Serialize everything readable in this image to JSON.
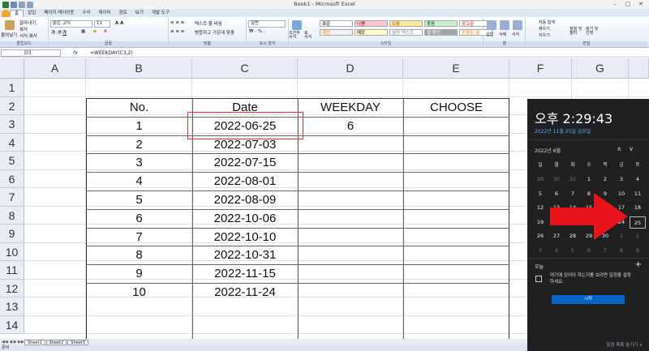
{
  "window": {
    "title": "Book1 - Microsoft Excel",
    "minimize": "–",
    "restore": "□",
    "close": "✕"
  },
  "ribbon_tabs": [
    "홈",
    "삽입",
    "페이지 레이아웃",
    "수식",
    "데이터",
    "검토",
    "보기",
    "개발 도구"
  ],
  "ribbon": {
    "clipboard": {
      "paste": "붙여넣기",
      "cut": "잘라내기",
      "copy": "복사",
      "format_painter": "서식 복사",
      "label": "클립보드"
    },
    "font": {
      "name": "맑은 고딕",
      "size": "11",
      "label": "글꼴"
    },
    "alignment": {
      "wrap": "텍스트 줄 바꿈",
      "merge": "병합하고 가운데 맞춤",
      "label": "맞춤"
    },
    "number": {
      "format": "일반",
      "label": "표시 형식"
    },
    "styles": {
      "conditional": "조건부\n서식",
      "table": "표\n서식",
      "cells": [
        {
          "text": "표준",
          "bg": "#ffffff",
          "fg": "#000000"
        },
        {
          "text": "나쁨",
          "bg": "#ffc7ce",
          "fg": "#9c0006"
        },
        {
          "text": "보통",
          "bg": "#ffeb9c",
          "fg": "#9c6500"
        },
        {
          "text": "좋음",
          "bg": "#c6efce",
          "fg": "#006100"
        },
        {
          "text": "경고문",
          "bg": "#ffffff",
          "fg": "#ff0000"
        },
        {
          "text": "계산",
          "bg": "#f2f2f2",
          "fg": "#fa7d00"
        },
        {
          "text": "메모",
          "bg": "#ffffcc",
          "fg": "#000000"
        },
        {
          "text": "설명 텍스트",
          "bg": "#ffffff",
          "fg": "#7f7f7f"
        },
        {
          "text": "셀 확인",
          "bg": "#a5a5a5",
          "fg": "#ffffff"
        },
        {
          "text": "연결된 셀",
          "bg": "#ffffff",
          "fg": "#fa7d00"
        }
      ],
      "label": "스타일"
    },
    "cells": {
      "insert": "삽입",
      "delete": "삭제",
      "format": "서식",
      "label": "셀"
    },
    "editing": {
      "autosum": "자동 합계",
      "fill": "채우기",
      "clear": "지우기",
      "sort": "정렬 및\n필터",
      "find": "찾기 및\n선택",
      "label": "편집"
    }
  },
  "formula_bar": {
    "name_box": "D3",
    "fx": "fx",
    "formula": "=WEEKDAY(C3,2)"
  },
  "columns": [
    "A",
    "B",
    "C",
    "D",
    "E",
    "F",
    "G"
  ],
  "rows": [
    "1",
    "2",
    "3",
    "4",
    "5",
    "6",
    "7",
    "8",
    "9",
    "10",
    "11",
    "12",
    "13",
    "14"
  ],
  "table": {
    "headers": [
      "No.",
      "Date",
      "WEEKDAY",
      "CHOOSE"
    ],
    "rows": [
      {
        "no": "1",
        "date": "2022-06-25",
        "weekday": "6",
        "choose": ""
      },
      {
        "no": "2",
        "date": "2022-07-03",
        "weekday": "",
        "choose": ""
      },
      {
        "no": "3",
        "date": "2022-07-15",
        "weekday": "",
        "choose": ""
      },
      {
        "no": "4",
        "date": "2022-08-01",
        "weekday": "",
        "choose": ""
      },
      {
        "no": "5",
        "date": "2022-08-09",
        "weekday": "",
        "choose": ""
      },
      {
        "no": "6",
        "date": "2022-10-06",
        "weekday": "",
        "choose": ""
      },
      {
        "no": "7",
        "date": "2022-10-10",
        "weekday": "",
        "choose": ""
      },
      {
        "no": "8",
        "date": "2022-10-31",
        "weekday": "",
        "choose": ""
      },
      {
        "no": "9",
        "date": "2022-11-15",
        "weekday": "",
        "choose": ""
      },
      {
        "no": "10",
        "date": "2022-11-24",
        "weekday": "",
        "choose": ""
      }
    ]
  },
  "sheets": [
    "Sheet1",
    "Sheet2",
    "Sheet3"
  ],
  "status": "준비",
  "calendar": {
    "time": "오후 2:29:43",
    "date": "2022년 11월 25일 금요일",
    "month": "2022년 6월",
    "up_icon": "∧",
    "down_icon": "∨",
    "weekdays": [
      "일",
      "월",
      "화",
      "수",
      "목",
      "금",
      "토"
    ],
    "weeks": [
      [
        "29",
        "30",
        "31",
        "1",
        "2",
        "3",
        "4"
      ],
      [
        "5",
        "6",
        "7",
        "8",
        "9",
        "10",
        "11"
      ],
      [
        "12",
        "13",
        "14",
        "15",
        "16",
        "17",
        "18"
      ],
      [
        "19",
        "20",
        "21",
        "22",
        "23",
        "24",
        "25"
      ],
      [
        "26",
        "27",
        "28",
        "29",
        "30",
        "1",
        "2"
      ],
      [
        "3",
        "4",
        "5",
        "6",
        "7",
        "8",
        "9"
      ]
    ],
    "today_label": "오늘",
    "add_icon": "+",
    "event_text": "여기에 있어야 하는지를 보려면 일정을 설정하세요.",
    "start_button": "시작",
    "hide_events": "일정 목록 숨기기 ∨"
  },
  "colors": {
    "highlight": "#e03030",
    "arrow": "#e8141c",
    "flyout_bg": "#202020",
    "accent": "#0063c6"
  }
}
